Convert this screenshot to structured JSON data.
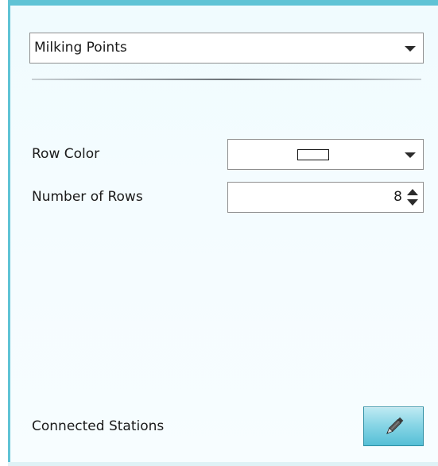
{
  "category_select": {
    "value": "Milking Points"
  },
  "row_color": {
    "label": "Row Color",
    "swatch_color": "#ffffff"
  },
  "number_of_rows": {
    "label": "Number of Rows",
    "value": "8"
  },
  "connected_stations": {
    "label": "Connected Stations",
    "edit_icon": "pencil-icon"
  },
  "colors": {
    "accent": "#5fc3d5",
    "button": "#8ad6e6"
  }
}
